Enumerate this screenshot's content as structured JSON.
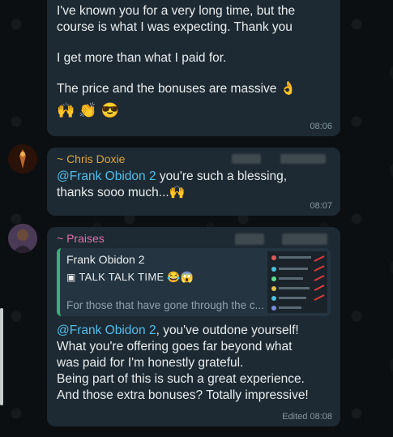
{
  "messages": [
    {
      "sender": "",
      "paragraphs": [
        "I've known you for a very long time, but the course is what I was expecting. Thank you",
        "I get more than what I paid for.",
        "The price and the bonuses are massive"
      ],
      "emoji_inline": "👌",
      "emoji_line": "🙌 👏 😎",
      "time": "08:06"
    },
    {
      "sender": "~ Chris Doxie",
      "mention": "@Frank Obidon 2",
      "text_after_mention": " you're such a blessing,",
      "text_line2": "thanks sooo much...",
      "emoji_inline": "🙌",
      "time": "08:07"
    },
    {
      "sender": "~ Praises",
      "quote": {
        "name": "Frank Obidon 2",
        "title": "TALK TALK TIME",
        "title_emoji": "😂😱",
        "body": "For those that have gone through the c..."
      },
      "mention": "@Frank Obidon 2",
      "text_after_mention": ", you've outdone yourself!",
      "lines": [
        "What you're offering goes far beyond what",
        "was paid for I'm honestly grateful.",
        "Being part of this is such a great experience.",
        "And those extra bonuses? Totally impressive!"
      ],
      "time": "Edited 08:08"
    }
  ],
  "colors": {
    "background": "#0b0f12",
    "bubble": "#1d2a33",
    "mention": "#53bdeb",
    "sender_orange": "#e0a23b",
    "sender_pink": "#e26faa",
    "quote_accent": "#39b27a",
    "timestamp": "#8696a0"
  }
}
